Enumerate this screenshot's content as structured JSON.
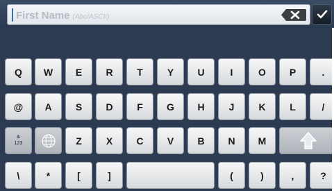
{
  "input": {
    "placeholder": "First Name",
    "hint": "(Abc/ASCII)"
  },
  "icons": {
    "backspace": "backspace-icon",
    "done": "checkmark-icon",
    "globe": "globe-icon",
    "shift": "shift-arrow-icon"
  },
  "keyboard": {
    "row1": [
      "Q",
      "W",
      "E",
      "R",
      "T",
      "Y",
      "U",
      "I",
      "O",
      "P",
      "."
    ],
    "row2": [
      "@",
      "A",
      "S",
      "D",
      "F",
      "G",
      "H",
      "J",
      "K",
      "L",
      "/"
    ],
    "row3": [
      "&\n123",
      "",
      "Z",
      "X",
      "C",
      "V",
      "B",
      "N",
      "M",
      ""
    ],
    "row4": [
      "\\",
      "*",
      "[",
      "]",
      "",
      "(",
      ")",
      ",",
      "?"
    ]
  },
  "colors": {
    "keyboard_bg": "#2c3b51",
    "key_light": "#f6f7f8",
    "key_dark": "#b7bcc2"
  }
}
